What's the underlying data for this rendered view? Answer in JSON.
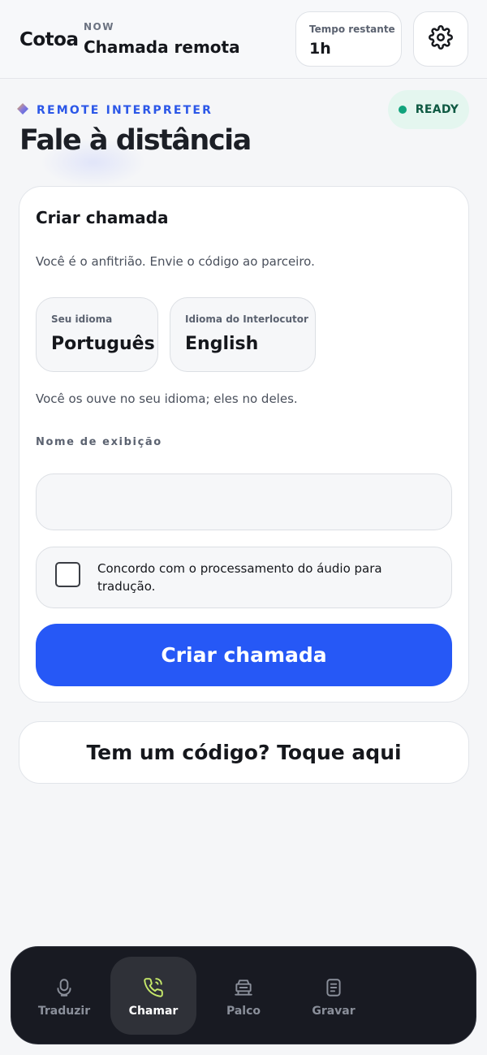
{
  "header": {
    "brand": "Cotoa",
    "now_label": "NOW",
    "title": "Chamada remota",
    "time_label": "Tempo restante",
    "time_value": "1h",
    "settings_icon": "gear-icon"
  },
  "hero": {
    "eyebrow": "REMOTE INTERPRETER",
    "status": "READY",
    "title": "Fale à distância"
  },
  "create_card": {
    "title": "Criar chamada",
    "subtitle": "Você é o anfitrião. Envie o código ao parceiro.",
    "your_language_label": "Seu idioma",
    "your_language_value": "Português",
    "partner_language_label": "Idioma do Interlocutor",
    "partner_language_value": "English",
    "language_note": "Você os ouve no seu idioma; eles no deles.",
    "display_name_label": "Nome de exibição",
    "display_name_value": "",
    "consent_text": "Concordo com o processamento do áudio para tradução.",
    "consent_checked": false,
    "submit_label": "Criar chamada"
  },
  "code_button": {
    "label": "Tem um código? Toque aqui"
  },
  "nav": {
    "items": [
      {
        "label": "Traduzir",
        "icon": "microphone-icon",
        "active": false
      },
      {
        "label": "Chamar",
        "icon": "phone-icon",
        "active": true
      },
      {
        "label": "Palco",
        "icon": "stage-icon",
        "active": false
      },
      {
        "label": "Gravar",
        "icon": "document-icon",
        "active": false
      }
    ]
  },
  "colors": {
    "accent": "#2658f6",
    "ready": "#11a37c",
    "nav_active_icon": "#c6e86a",
    "nav_background": "#181a22"
  }
}
